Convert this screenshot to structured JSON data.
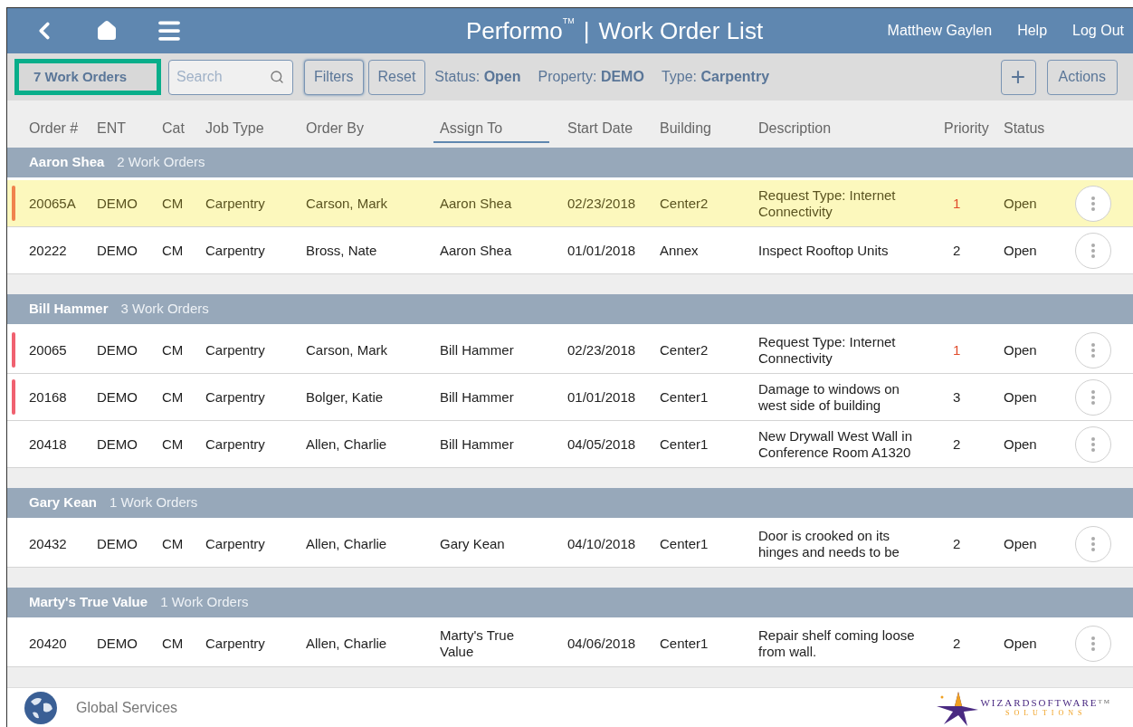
{
  "header": {
    "brand": "Performo",
    "trademark": "TM",
    "separator": "|",
    "title": "Work Order List",
    "user": "Matthew Gaylen",
    "links": [
      "Help",
      "Log Out"
    ]
  },
  "toolbar": {
    "count": {
      "label": "7 Work Orders",
      "highlighted": true
    },
    "search": {
      "placeholder": "Search"
    },
    "buttons": [
      "Filters",
      "Reset"
    ],
    "filters": [
      {
        "label": "Status:",
        "value": "Open"
      },
      {
        "label": "Property:",
        "value": "DEMO"
      },
      {
        "label": "Type:",
        "value": "Carpentry"
      }
    ],
    "add_button": "+",
    "actions_button": "Actions"
  },
  "table": {
    "columns": [
      {
        "label": "Order #",
        "sorted": false
      },
      {
        "label": "ENT",
        "sorted": false
      },
      {
        "label": "Cat",
        "sorted": false
      },
      {
        "label": "Job Type",
        "sorted": false
      },
      {
        "label": "Order By",
        "sorted": false
      },
      {
        "label": "Assign To",
        "sorted": true
      },
      {
        "label": "Start Date",
        "sorted": false
      },
      {
        "label": "Building",
        "sorted": false
      },
      {
        "label": "Description",
        "sorted": false
      },
      {
        "label": "Priority",
        "sorted": false
      },
      {
        "label": "Status",
        "sorted": false
      }
    ],
    "groups": [
      {
        "name": "Aaron Shea",
        "count": "2 Work Orders",
        "rows": [
          {
            "cells": [
              "20065A",
              "DEMO",
              "CM",
              "Carpentry",
              "Carson, Mark",
              "Aaron Shea",
              "02/23/2018",
              "Center2",
              "Request Type: Internet Connectivity",
              "1",
              "Open"
            ],
            "selected": true,
            "flagged": true,
            "urgent": true
          },
          {
            "cells": [
              "20222",
              "DEMO",
              "CM",
              "Carpentry",
              "Bross, Nate",
              "Aaron Shea",
              "01/01/2018",
              "Annex",
              "Inspect Rooftop Units",
              "2",
              "Open"
            ],
            "selected": false,
            "flagged": false,
            "urgent": false
          }
        ]
      },
      {
        "name": "Bill Hammer",
        "count": "3 Work Orders",
        "rows": [
          {
            "cells": [
              "20065",
              "DEMO",
              "CM",
              "Carpentry",
              "Carson, Mark",
              "Bill Hammer",
              "02/23/2018",
              "Center2",
              "Request Type: Internet Connectivity",
              "1",
              "Open"
            ],
            "selected": false,
            "flagged": true,
            "urgent": true
          },
          {
            "cells": [
              "20168",
              "DEMO",
              "CM",
              "Carpentry",
              "Bolger, Katie",
              "Bill Hammer",
              "01/01/2018",
              "Center1",
              "Damage to windows on west side of building",
              "3",
              "Open"
            ],
            "selected": false,
            "flagged": true,
            "urgent": false
          },
          {
            "cells": [
              "20418",
              "DEMO",
              "CM",
              "Carpentry",
              "Allen, Charlie",
              "Bill Hammer",
              "04/05/2018",
              "Center1",
              "New Drywall West Wall in Conference Room A1320",
              "2",
              "Open"
            ],
            "selected": false,
            "flagged": false,
            "urgent": false
          }
        ]
      },
      {
        "name": "Gary Kean",
        "count": "1 Work Orders",
        "rows": [
          {
            "cells": [
              "20432",
              "DEMO",
              "CM",
              "Carpentry",
              "Allen, Charlie",
              "Gary Kean",
              "04/10/2018",
              "Center1",
              "Door is crooked on its hinges and needs to be",
              "2",
              "Open"
            ],
            "selected": false,
            "flagged": false,
            "urgent": false
          }
        ]
      },
      {
        "name": "Marty's True Value",
        "count": "1 Work Orders",
        "rows": [
          {
            "cells": [
              "20420",
              "DEMO",
              "CM",
              "Carpentry",
              "Allen, Charlie",
              "Marty's True Value",
              "04/06/2018",
              "Center1",
              "Repair shelf coming loose from wall.",
              "2",
              "Open"
            ],
            "selected": false,
            "flagged": false,
            "urgent": false
          }
        ]
      }
    ]
  },
  "footer": {
    "site": "Global Services",
    "logo": {
      "name": "WIZARDSOFTWARE",
      "tagline": "SOLUTIONS",
      "trademark": "TM"
    }
  }
}
